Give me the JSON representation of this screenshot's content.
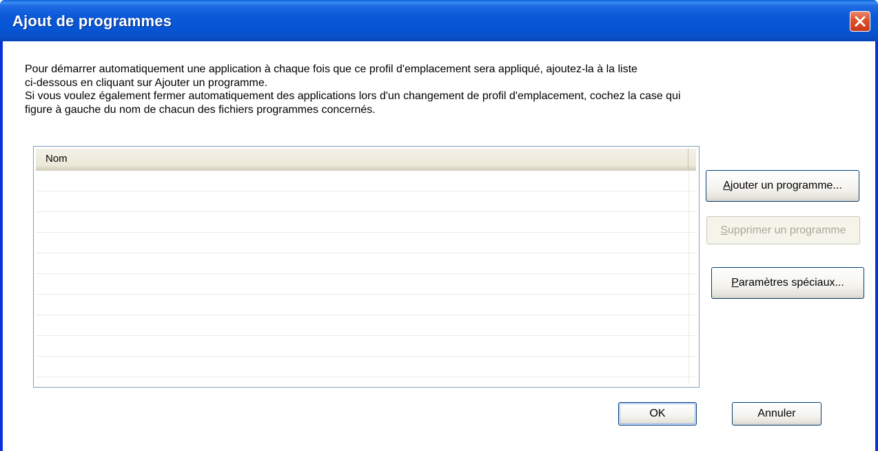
{
  "window": {
    "title": "Ajout de programmes"
  },
  "description": {
    "line1": "Pour démarrer automatiquement une application à chaque fois que ce profil d'emplacement sera appliqué, ajoutez-la à la liste",
    "line2": "ci-dessous en cliquant sur Ajouter un programme.",
    "line3": "Si vous voulez également fermer automatiquement des applications lors d'un changement de profil d'emplacement, cochez la case qui",
    "line4": "figure à gauche du nom de chacun des fichiers programmes concernés."
  },
  "list": {
    "column_header": "Nom",
    "rows": []
  },
  "buttons": {
    "add": {
      "accel": "A",
      "rest": "jouter un programme..."
    },
    "remove": {
      "accel": "S",
      "rest": "upprimer un programme",
      "enabled": false
    },
    "special": {
      "accel": "P",
      "rest": "aramètres spéciaux..."
    },
    "ok": "OK",
    "cancel": "Annuler"
  },
  "colors": {
    "titlebar": "#0a58d8",
    "close": "#e0532d",
    "list_border": "#7f9db9",
    "button_border": "#003c74",
    "disabled_text": "#aca899"
  },
  "icons": {
    "close": "close-icon"
  }
}
